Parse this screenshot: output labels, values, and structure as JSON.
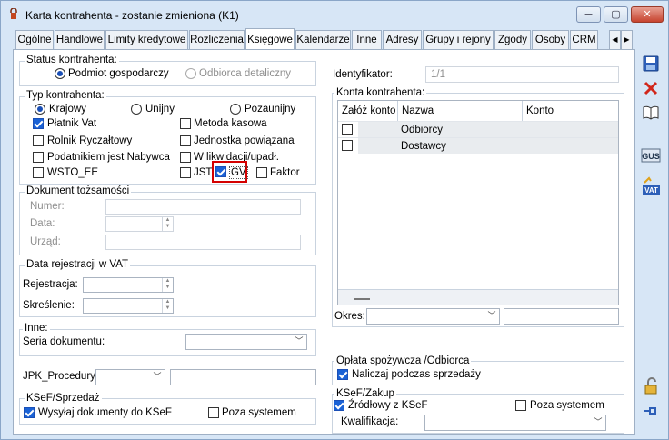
{
  "window": {
    "title": "Karta kontrahenta - zostanie zmieniona (K1)",
    "minimize": "─",
    "restore": "▢",
    "close": "✕"
  },
  "tabs": [
    "Ogólne",
    "Handlowe",
    "Limity kredytowe",
    "Rozliczenia",
    "Księgowe",
    "Kalendarze",
    "Inne",
    "Adresy",
    "Grupy i rejony",
    "Zgody",
    "Osoby",
    "CRM"
  ],
  "active_tab": "Księgowe",
  "status": {
    "label": "Status kontrahenta:",
    "option1": "Podmiot gospodarczy",
    "option2": "Odbiorca detaliczny"
  },
  "typ": {
    "label": "Typ kontrahenta:",
    "krajowy": "Krajowy",
    "unijny": "Unijny",
    "pozaunijny": "Pozaunijny",
    "platnik_vat": "Płatnik Vat",
    "metoda_kasowa": "Metoda kasowa",
    "rolnik": "Rolnik Ryczałtowy",
    "jednostka": "Jednostka powiązana",
    "podatnik": "Podatnikiem jest Nabywca",
    "likwidacja": "W likwidacji/upadł.",
    "wsto": "WSTO_EE",
    "jst": "JST",
    "gv": "GV",
    "faktor": "Faktor"
  },
  "dokument": {
    "label": "Dokument tożsamości",
    "numer": "Numer:",
    "data": "Data:",
    "urzad": "Urząd:"
  },
  "rejestracja": {
    "label": "Data rejestracji w VAT",
    "rejestracja": "Rejestracja:",
    "skreslenie": "Skreślenie:"
  },
  "inne": {
    "label": "Inne:",
    "seria": "Seria dokumentu:"
  },
  "jpk": {
    "label": "JPK_Procedury:"
  },
  "ksef_sprzedaz": {
    "label": "KSeF/Sprzedaż",
    "wysylaj": "Wysyłaj dokumenty do KSeF",
    "poza": "Poza systemem"
  },
  "identyfikator": {
    "label": "Identyfikator:",
    "value": "1/1"
  },
  "konta": {
    "label": "Konta kontrahenta:",
    "columns": [
      "Załóż konto",
      "Nazwa",
      "Konto"
    ],
    "rows": [
      "Odbiorcy",
      "Dostawcy"
    ],
    "okres": "Okres:"
  },
  "oplata": {
    "label": "Opłata spożywcza /Odbiorca",
    "naliczaj": "Naliczaj podczas sprzedaży"
  },
  "ksef_zakup": {
    "label": "KSeF/Zakup",
    "zrodlowy": "Źródłowy z KSeF",
    "poza": "Poza systemem",
    "kwalifikacja": "Kwalifikacja:"
  },
  "colors": {
    "accent": "#1a62d6",
    "highlight_border": "#d40000"
  }
}
